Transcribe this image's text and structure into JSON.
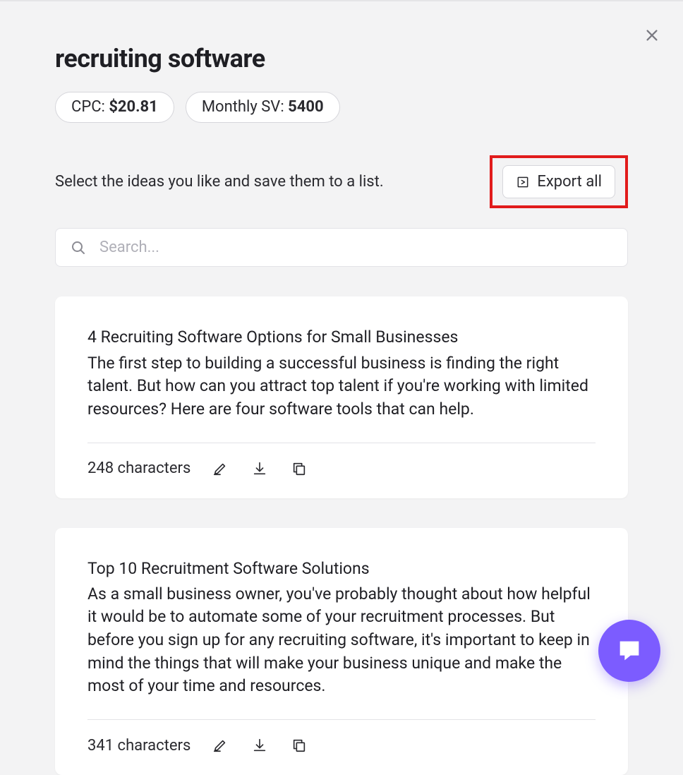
{
  "header": {
    "title": "recruiting software",
    "cpc_label": "CPC: ",
    "cpc_value": "$20.81",
    "sv_label": "Monthly SV: ",
    "sv_value": "5400"
  },
  "actions": {
    "instruction": "Select the ideas you like and save them to a list.",
    "export_label": "Export all"
  },
  "search": {
    "placeholder": "Search..."
  },
  "ideas": [
    {
      "title": "4 Recruiting Software Options for Small Businesses",
      "description": "The first step to building a successful business is finding the right talent. But how can you attract top talent if you're working with limited resources? Here are four software tools that can help.",
      "char_count": "248 characters"
    },
    {
      "title": "Top 10 Recruitment Software Solutions",
      "description": "As a small business owner, you've probably thought about how helpful it would be to automate some of your recruitment processes. But before you sign up for any recruiting software, it's important to keep in mind the things that will make your business unique and make the most of your time and resources.",
      "char_count": "341 characters"
    }
  ]
}
